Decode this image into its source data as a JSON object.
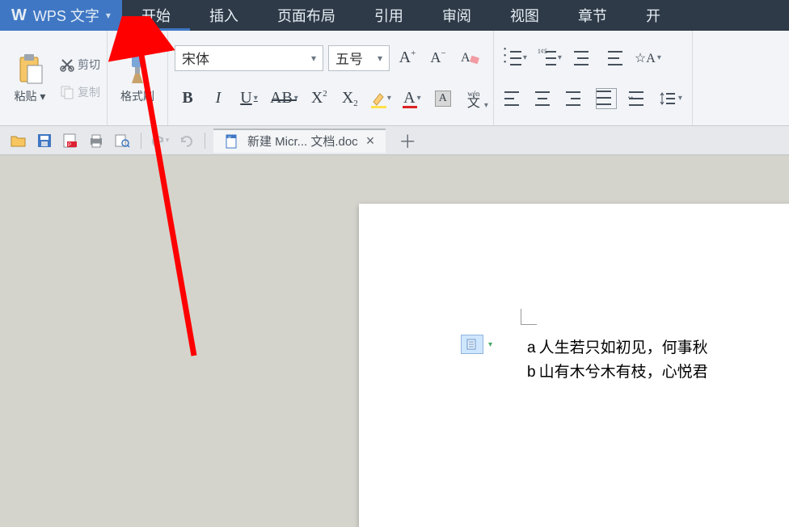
{
  "app": {
    "name": "WPS 文字"
  },
  "menu": {
    "items": [
      "开始",
      "插入",
      "页面布局",
      "引用",
      "审阅",
      "视图",
      "章节",
      "开"
    ],
    "active_index": 0
  },
  "ribbon": {
    "clipboard": {
      "paste": "粘贴",
      "cut": "剪切",
      "copy": "复制"
    },
    "format_painter": "格式刷",
    "font": {
      "name": "宋体",
      "size": "五号",
      "bold": "B",
      "italic": "I",
      "underline": "U",
      "strike": "AB",
      "super": "X",
      "sub": "X",
      "highlight": "A",
      "fontcolor": "A",
      "shading": "A",
      "phonetic": "wén 文"
    },
    "grow_hint": "A",
    "shrink_hint": "A",
    "clear_hint": "A"
  },
  "quick": {
    "doc_tab": "新建 Micr... 文档.doc"
  },
  "document": {
    "lines": [
      {
        "prefix": "a",
        "text": "人生若只如初见，何事秋"
      },
      {
        "prefix": "b",
        "text": "山有木兮木有枝，心悦君"
      }
    ]
  },
  "colors": {
    "accent": "#3f77c4",
    "menubar_bg": "#2e3a47",
    "arrow": "#ff0000"
  }
}
